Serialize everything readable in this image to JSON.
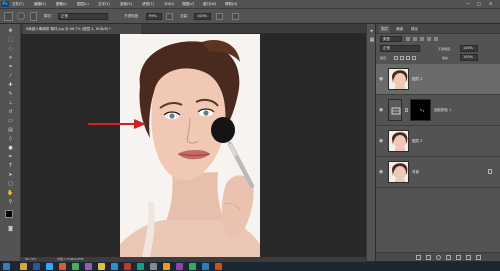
{
  "app": {
    "logo": "Ps"
  },
  "menu": [
    "文件(F)",
    "编辑(E)",
    "图像(I)",
    "图层(L)",
    "文字(Y)",
    "选择(S)",
    "滤镜(T)",
    "3D(D)",
    "视图(V)",
    "窗口(W)",
    "帮助(H)"
  ],
  "window_controls": [
    "—",
    "□",
    "✕"
  ],
  "options": {
    "mode_label": "模式:",
    "mode_value": "正常",
    "opacity_label": "不透明度:",
    "opacity_value": "99%",
    "flow_label": "流量:",
    "flow_value": "100%"
  },
  "document": {
    "tab_title": "6局部人像精修 素材.jpg @ 66.7% (图层 4, RGB/8) *",
    "zoom": "66.74%",
    "doc_info": "文档:1.53M/4.65M"
  },
  "layers_panel": {
    "tabs": [
      "图层",
      "通道",
      "路径"
    ],
    "filter_label": "类型",
    "blend_mode": "正常",
    "opacity_label": "不透明度:",
    "opacity_value": "100%",
    "lock_label": "锁定:",
    "fill_label": "填充:",
    "fill_value": "100%",
    "layers": [
      {
        "name": "图层 4",
        "selected": true,
        "kind": "photo"
      },
      {
        "name": "选取颜色 1",
        "selected": false,
        "kind": "adjustment"
      },
      {
        "name": "图层 3",
        "selected": false,
        "kind": "photo"
      },
      {
        "name": "背景",
        "selected": false,
        "kind": "photo"
      }
    ]
  },
  "colors": {
    "panel": "#535353",
    "canvas": "#282828",
    "arrow": "#d42020",
    "selected_layer": "#6b6b6b"
  }
}
